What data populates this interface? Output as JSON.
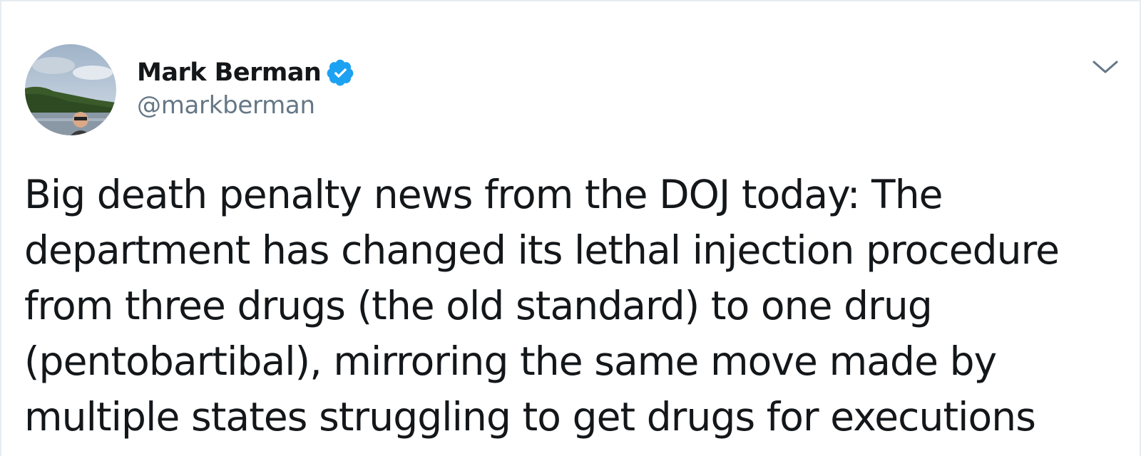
{
  "author": {
    "name": "Mark Berman",
    "handle": "@markberman",
    "verified": true,
    "avatar_icon": "profile-photo"
  },
  "tweet": {
    "text": "Big death penalty news from the DOJ today: The\ndepartment has changed its lethal injection procedure\nfrom three drugs (the old standard) to one drug\n(pentobartibal), mirroring the same move made by\nmultiple states struggling to get drugs for executions"
  },
  "menu": {
    "icon": "chevron-down-icon"
  },
  "colors": {
    "name": "#14171a",
    "handle": "#657786",
    "verified": "#1da1f2",
    "text": "#14171a",
    "caret": "#657786",
    "border": "#e6ecf0"
  }
}
